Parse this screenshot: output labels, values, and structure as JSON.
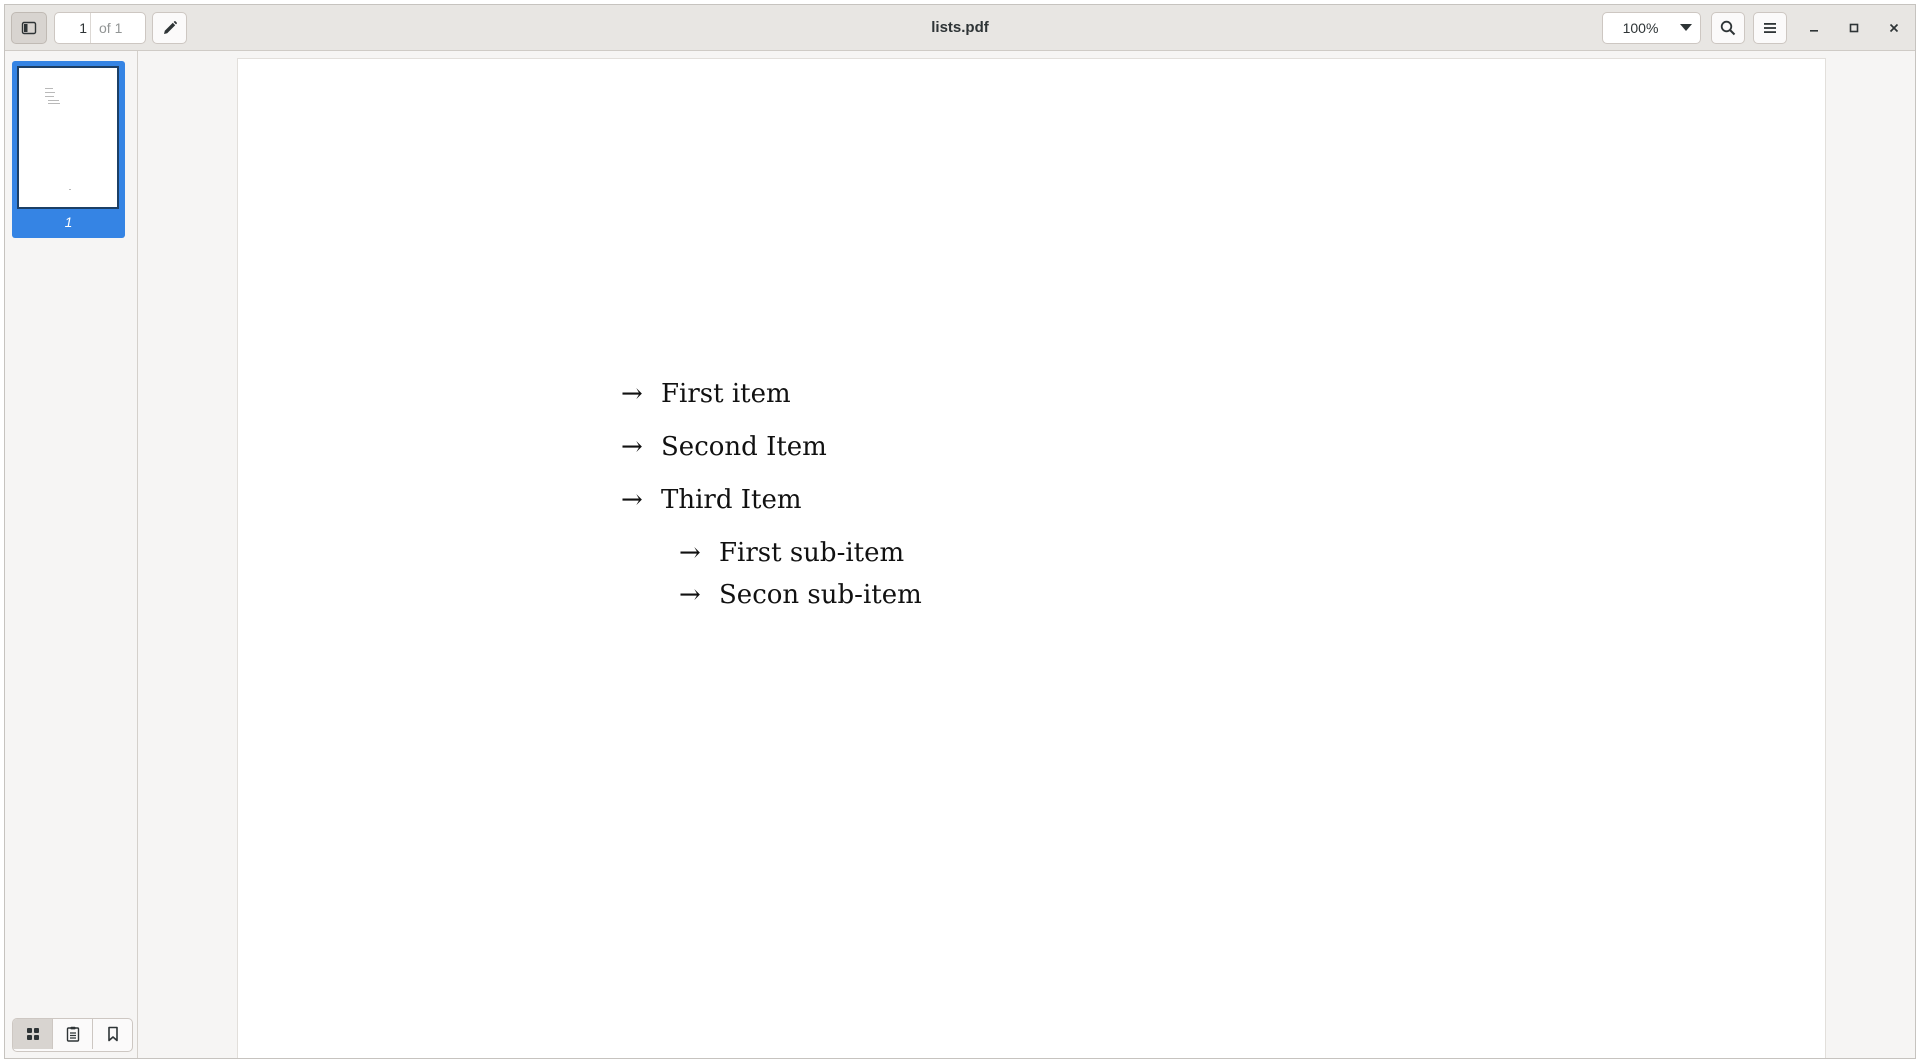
{
  "headerbar": {
    "title": "lists.pdf",
    "page_current": "1",
    "page_total_label": "of 1",
    "zoom_level": "100%"
  },
  "sidebar": {
    "thumbnails": [
      {
        "label": "1",
        "selected": true
      }
    ],
    "view_modes": [
      "thumbnails-icon",
      "outline-icon",
      "bookmarks-icon"
    ]
  },
  "document": {
    "items": [
      {
        "bullet": "→",
        "text": "First item"
      },
      {
        "bullet": "→",
        "text": "Second Item"
      },
      {
        "bullet": "→",
        "text": "Third Item"
      }
    ],
    "subitems": [
      {
        "bullet": "→",
        "text": "First sub-item"
      },
      {
        "bullet": "→",
        "text": "Secon sub-item"
      }
    ]
  },
  "colors": {
    "accent": "#3584e4",
    "headerbar": "#e8e6e3",
    "background": "#f6f5f4"
  }
}
